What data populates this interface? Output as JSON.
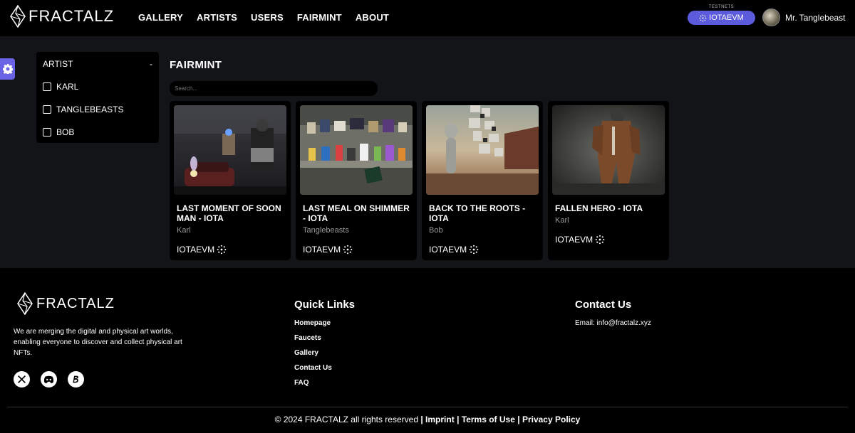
{
  "brand": {
    "name": "FRACTALZ"
  },
  "nav": [
    "GALLERY",
    "ARTISTS",
    "USERS",
    "FAIRMINT",
    "ABOUT"
  ],
  "network": {
    "label": "TESTNETS",
    "selected": "IOTAEVM"
  },
  "user": {
    "name": "Mr. Tanglebeast"
  },
  "filter": {
    "heading": "ARTIST",
    "toggle": "-",
    "options": [
      "KARL",
      "TANGLEBEASTS",
      "BOB"
    ]
  },
  "page": {
    "title": "FAIRMINT",
    "search_placeholder": "Search..."
  },
  "cards": [
    {
      "title": "LAST MOMENT OF SOON MAN - IOTA",
      "artist": "Karl",
      "network": "IOTAEVM"
    },
    {
      "title": "LAST MEAL ON SHIMMER - IOTA",
      "artist": "Tanglebeasts",
      "network": "IOTAEVM"
    },
    {
      "title": "BACK TO THE ROOTS - IOTA",
      "artist": "Bob",
      "network": "IOTAEVM"
    },
    {
      "title": "FALLEN HERO - IOTA",
      "artist": "Karl",
      "network": "IOTAEVM"
    }
  ],
  "footer": {
    "brand": "FRACTALZ",
    "description": "We are merging the digital and physical art worlds, enabling everyone to discover and collect physical art NFTs.",
    "quick_links_title": "Quick Links",
    "quick_links": [
      "Homepage",
      "Faucets",
      "Gallery",
      "Contact Us",
      "FAQ"
    ],
    "contact_title": "Contact Us",
    "email": "Email: info@fractalz.xyz",
    "copyright": "© 2024 FRACTALZ all rights reserved",
    "legal_links": [
      "Imprint",
      "Terms of Use",
      "Privacy Policy"
    ]
  },
  "colors": {
    "accent": "#5b5bdc",
    "background": "#121418",
    "panel": "#000000"
  }
}
